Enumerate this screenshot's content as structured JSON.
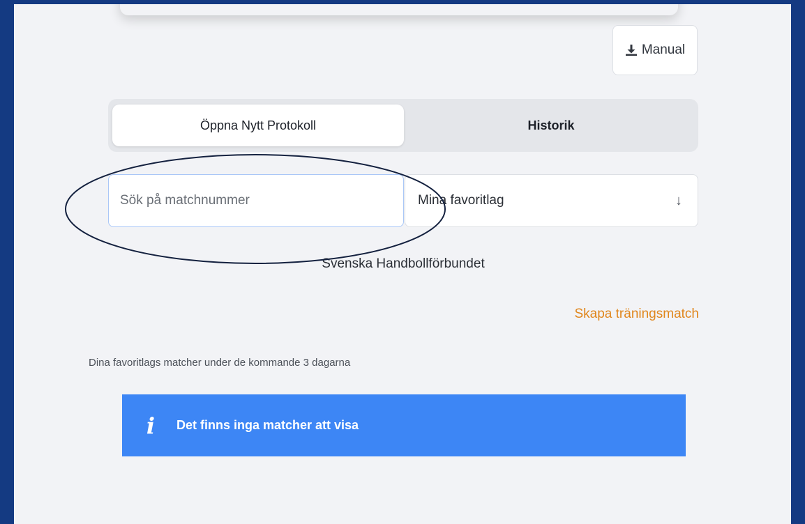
{
  "toolbar": {
    "manual_label": "Manual",
    "manual_icon": "download-icon"
  },
  "tabs": [
    {
      "label": "Öppna Nytt Protokoll",
      "active": true
    },
    {
      "label": "Historik",
      "active": false
    }
  ],
  "search": {
    "placeholder": "Sök på matchnummer",
    "value": ""
  },
  "favorites_select": {
    "selected": "Mina favoritlag",
    "icon": "arrow-down-icon"
  },
  "organization": "Svenska Handbollförbundet",
  "training_link": "Skapa träningsmatch",
  "upcoming_label": "Dina favoritlags matcher under de kommande 3 dagarna",
  "info_banner": {
    "icon": "i",
    "message": "Det finns inga matcher att visa"
  },
  "colors": {
    "outer_background": "#143a82",
    "page_background": "#f2f3f6",
    "accent_link": "#e0861c",
    "info_banner": "#3d86f5",
    "annotation": "#14213f"
  }
}
